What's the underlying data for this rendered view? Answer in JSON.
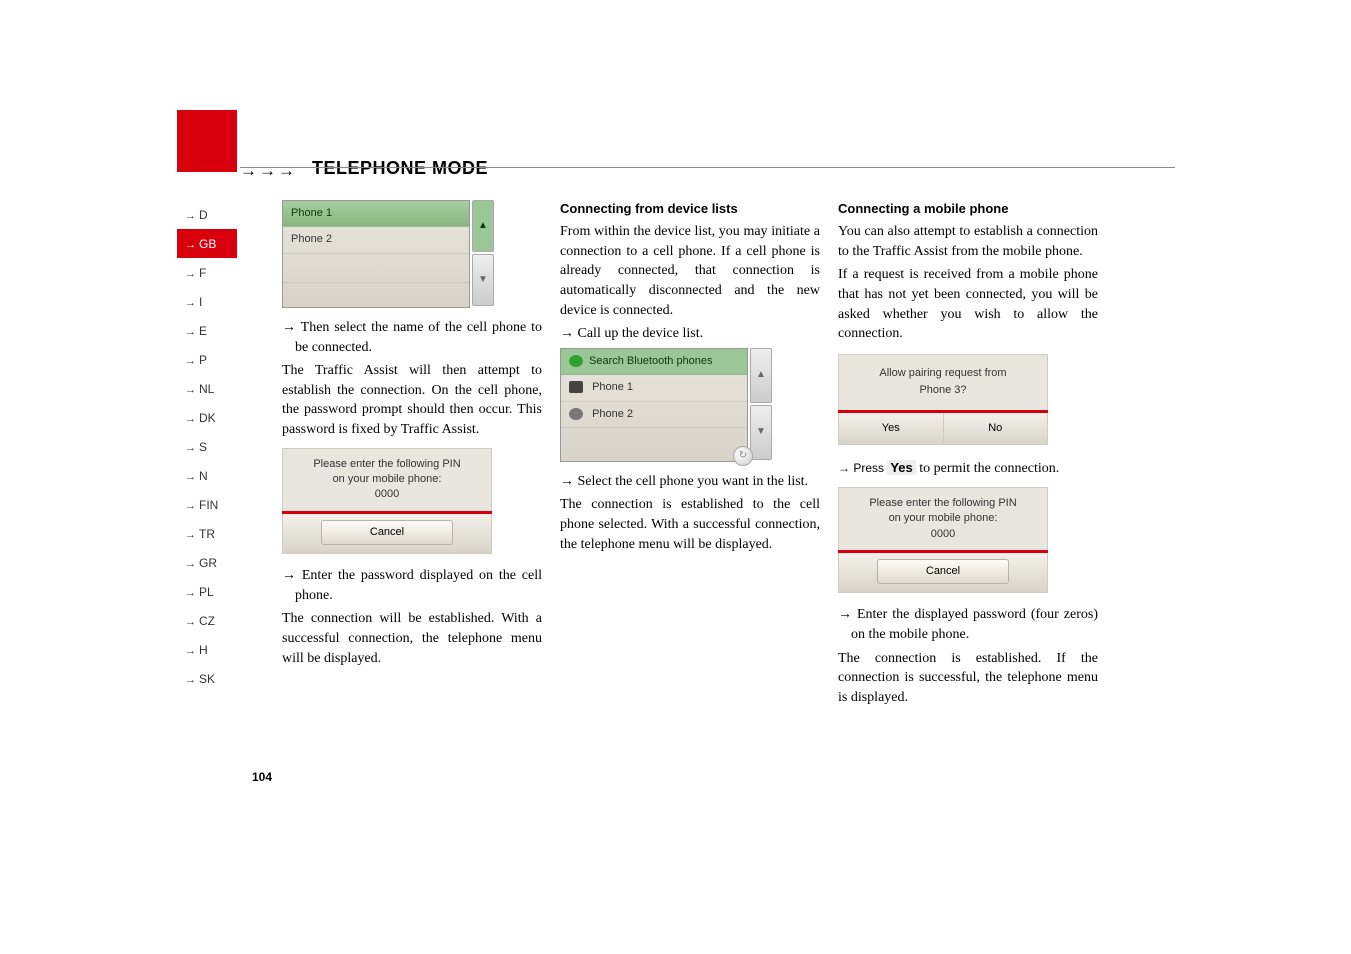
{
  "header": {
    "arrows": "→→→",
    "title": "TELEPHONE MODE"
  },
  "sidebar": {
    "items": [
      {
        "arrow": "→",
        "code": "D"
      },
      {
        "arrow": "→",
        "code": "GB"
      },
      {
        "arrow": "→",
        "code": "F"
      },
      {
        "arrow": "→",
        "code": "I"
      },
      {
        "arrow": "→",
        "code": "E"
      },
      {
        "arrow": "→",
        "code": "P"
      },
      {
        "arrow": "→",
        "code": "NL"
      },
      {
        "arrow": "→",
        "code": "DK"
      },
      {
        "arrow": "→",
        "code": "S"
      },
      {
        "arrow": "→",
        "code": "N"
      },
      {
        "arrow": "→",
        "code": "FIN"
      },
      {
        "arrow": "→",
        "code": "TR"
      },
      {
        "arrow": "→",
        "code": "GR"
      },
      {
        "arrow": "→",
        "code": "PL"
      },
      {
        "arrow": "→",
        "code": "CZ"
      },
      {
        "arrow": "→",
        "code": "H"
      },
      {
        "arrow": "→",
        "code": "SK"
      }
    ],
    "active_index": 1
  },
  "col1": {
    "phone_list": {
      "rows": [
        "Phone 1",
        "Phone 2"
      ],
      "up": "▲",
      "down": "▼"
    },
    "step1": "→ Then select the name of the cell phone to be connected.",
    "para1": "The Traffic Assist will then attempt to establish the connection. On the cell phone, the password prompt should then occur. This password is fixed by Traffic Assist.",
    "pin": {
      "line1": "Please enter the following PIN",
      "line2": "on your mobile phone:",
      "code": "0000",
      "cancel": "Cancel"
    },
    "step2": "→ Enter the password displayed on the cell phone.",
    "para2": "The connection will be established. With a successful connection, the telephone menu will be displayed."
  },
  "col2": {
    "heading": "Connecting from device lists",
    "para1": "From within the device list, you may initiate a connection to a cell phone. If a cell phone is already connected, that connection is automatically disconnected and the new device is connected.",
    "step1": "→ Call up the device list.",
    "device_list": {
      "title": "Search Bluetooth phones",
      "rows": [
        "Phone 1",
        "Phone 2"
      ],
      "up": "▲",
      "down": "▼",
      "refresh": "↻"
    },
    "step2": "→ Select the cell phone you want in the list.",
    "para2": "The connection is established to the cell phone selected. With a successful connection, the telephone menu will be displayed."
  },
  "col3": {
    "heading": "Connecting a mobile phone",
    "para1": "You can also attempt to establish a connection to the Traffic Assist from the mobile phone.",
    "para2": "If a request is received from a mobile phone that has not yet been connected, you will be asked whether you wish to allow the connection.",
    "pair": {
      "line1": "Allow pairing request from",
      "line2": "Phone 3?",
      "yes": "Yes",
      "no": "No"
    },
    "step1_pre": "→ Press ",
    "step1_word": "Yes",
    "step1_post": " to permit the connection.",
    "pin": {
      "line1": "Please enter the following PIN",
      "line2": "on your mobile phone:",
      "code": "0000",
      "cancel": "Cancel"
    },
    "step2": "→ Enter the displayed password (four zeros) on the mobile phone.",
    "para3": "The connection is established. If the connection is successful, the telephone menu is displayed."
  },
  "page_number": "104"
}
